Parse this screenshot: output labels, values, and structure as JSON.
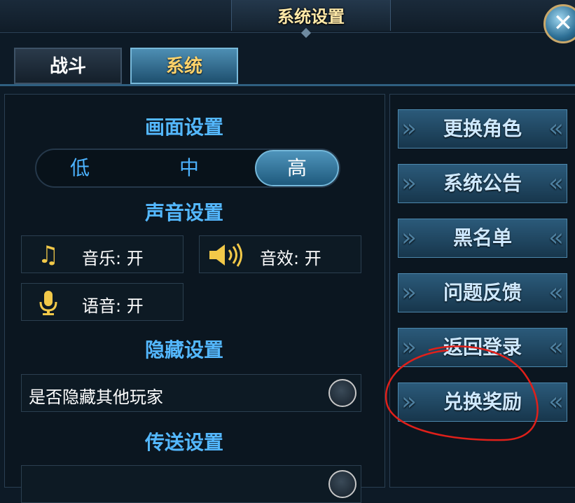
{
  "header": {
    "title": "系统设置",
    "close_icon": "close-icon"
  },
  "tabs": [
    {
      "label": "战斗",
      "active": false
    },
    {
      "label": "系统",
      "active": true
    }
  ],
  "graphics": {
    "title": "画面设置",
    "options": [
      "低",
      "中",
      "高"
    ],
    "selected": "高"
  },
  "sound": {
    "title": "声音设置",
    "music": {
      "icon": "music-note-icon",
      "label": "音乐: 开"
    },
    "effects": {
      "icon": "speaker-icon",
      "label": "音效: 开"
    },
    "voice": {
      "icon": "microphone-icon",
      "label": "语音: 开"
    }
  },
  "hide": {
    "title": "隐藏设置",
    "option": "是否隐藏其他玩家"
  },
  "teleport": {
    "title": "传送设置"
  },
  "side_menu": [
    "更换角色",
    "系统公告",
    "黑名单",
    "问题反馈",
    "返回登录",
    "兑换奖励"
  ],
  "colors": {
    "accent_blue": "#54b8ff",
    "gold_title": "#ffe9a8",
    "annotation_red": "#e0201a"
  }
}
